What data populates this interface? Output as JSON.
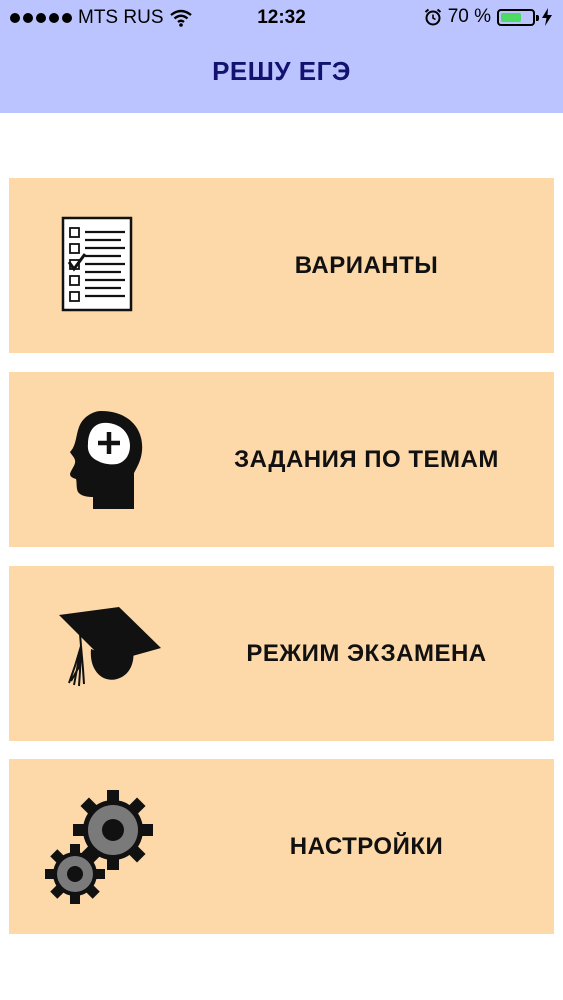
{
  "status_bar": {
    "carrier": "MTS RUS",
    "time": "12:32",
    "battery_percent": "70 %",
    "battery_level": 0.7,
    "icons": [
      "signal-dots-icon",
      "wifi-icon",
      "alarm-icon",
      "battery-icon",
      "charging-bolt-icon"
    ]
  },
  "header": {
    "title": "РЕШУ ЕГЭ",
    "background": "#bcc4ff",
    "title_color": "#13126e"
  },
  "menu": {
    "card_color": "#fdd8a8",
    "items": [
      {
        "label": "ВАРИАНТЫ",
        "icon": "checklist-icon"
      },
      {
        "label": "ЗАДАНИЯ ПО ТЕМАМ",
        "icon": "brain-head-icon"
      },
      {
        "label": "РЕЖИМ ЭКЗАМЕНА",
        "icon": "graduation-cap-icon"
      },
      {
        "label": "НАСТРОЙКИ",
        "icon": "gears-icon"
      }
    ]
  }
}
